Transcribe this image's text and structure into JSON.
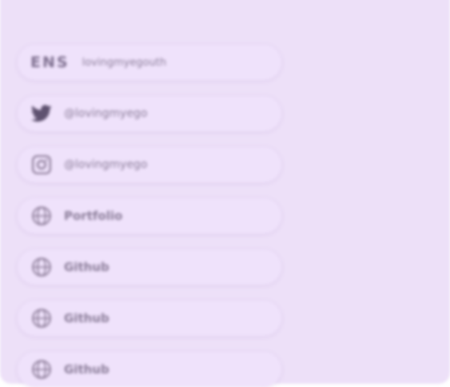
{
  "links": [
    {
      "icon": "ens-logo",
      "mark": "ENS",
      "label": "lovingmyegouth"
    },
    {
      "icon": "twitter-icon",
      "label": "@lovingmyego"
    },
    {
      "icon": "instagram-icon",
      "label": "@lovingmyego"
    },
    {
      "icon": "globe-icon",
      "label": "Portfolio"
    },
    {
      "icon": "globe-icon",
      "label": "Github"
    },
    {
      "icon": "globe-icon",
      "label": "Github"
    },
    {
      "icon": "globe-icon",
      "label": "Github"
    }
  ],
  "colors": {
    "panel_bg": "#ede0f8",
    "row_bg": "#efe2fb",
    "text": "#8b7d99"
  }
}
